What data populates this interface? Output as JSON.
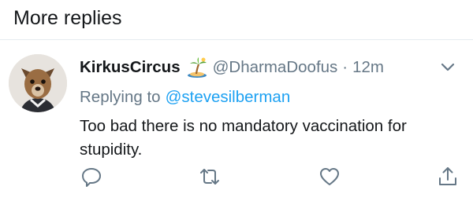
{
  "section": {
    "title": "More replies"
  },
  "tweet": {
    "display_name": "KirkusCircus",
    "name_emoji": "desert-island-emoji",
    "handle": "@DharmaDoofus",
    "separator": "·",
    "timestamp": "12m",
    "replying_to_label": "Replying to",
    "replying_to_user": "@stevesilberman",
    "text": "Too bad there is no mandatory vaccination for stupidity."
  },
  "actions": {
    "icons": [
      "reply-icon",
      "retweet-icon",
      "like-icon",
      "share-icon"
    ]
  },
  "colors": {
    "text": "#14171a",
    "secondary": "#657786",
    "link": "#1da1f2",
    "divider": "#e6ecf0"
  }
}
